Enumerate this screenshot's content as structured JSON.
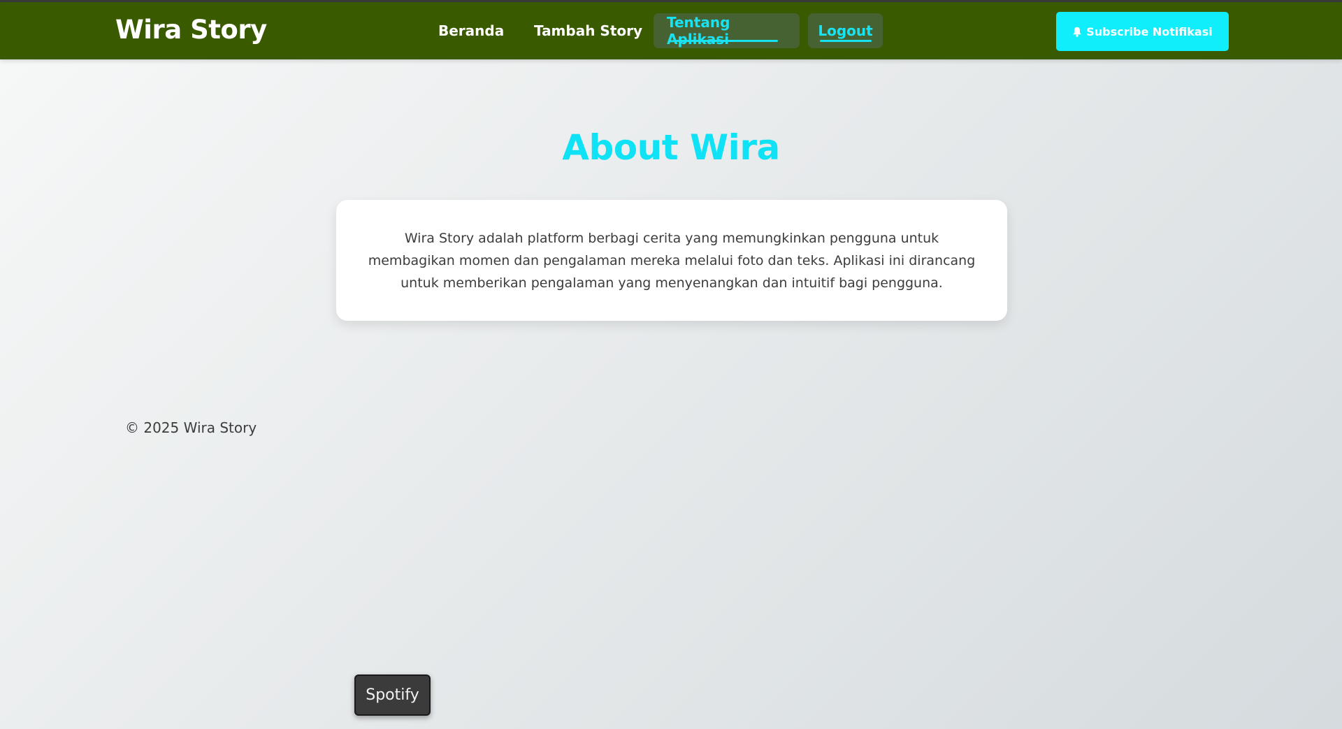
{
  "navbar": {
    "brand": "Wira Story",
    "links": [
      {
        "label": "Beranda"
      },
      {
        "label": "Tambah Story"
      },
      {
        "label": "Tentang Aplikasi",
        "active": true
      },
      {
        "label": "Logout",
        "active": true
      }
    ],
    "subscribe_label": "Subscribe Notifikasi",
    "subscribe_icon": "bell-icon",
    "background_color": "#3a5a00",
    "accent_color": "#19e3f2"
  },
  "main": {
    "title": "About Wira",
    "description": "Wira Story adalah platform berbagi cerita yang memungkinkan pengguna untuk membagikan momen dan pengalaman mereka melalui foto dan teks. Aplikasi ini dirancang untuk memberikan pengalaman yang menyenangkan dan intuitif bagi pengguna."
  },
  "footer": {
    "copyright": "© 2025 Wira Story"
  },
  "tooltip": {
    "label": "Spotify"
  }
}
